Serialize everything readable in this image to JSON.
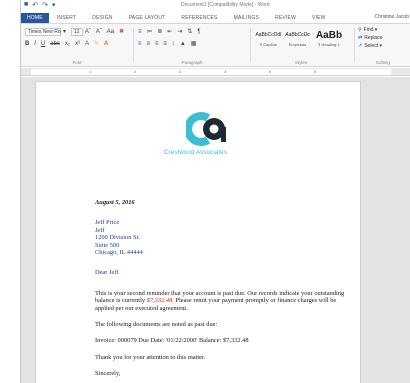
{
  "window": {
    "title": "Document1 [Compatibility Mode] - Word",
    "user": "Christine Jacob"
  },
  "tabs": [
    "HOME",
    "INSERT",
    "DESIGN",
    "PAGE LAYOUT",
    "REFERENCES",
    "MAILINGS",
    "REVIEW",
    "VIEW"
  ],
  "ribbon": {
    "font": {
      "name": "Times New Ro",
      "size": "12",
      "label": "Font"
    },
    "paragraph": {
      "label": "Paragraph"
    },
    "styles": {
      "label": "Styles",
      "items": [
        {
          "sample": "AaBbCcDdI",
          "name": "¶ Caption"
        },
        {
          "sample": "AaBbCcDc",
          "name": "Emphasis"
        },
        {
          "sample": "AaBb",
          "name": "¶ Heading 1"
        }
      ]
    },
    "editing": {
      "label": "Editing",
      "find": "Find",
      "replace": "Replace",
      "select": "Select"
    }
  },
  "ruler": [
    "1",
    "2",
    "3",
    "4",
    "5",
    "6"
  ],
  "document": {
    "logo_text": "Crestwood Associates",
    "date": "August 5, 2016",
    "address": [
      "Jeff Price",
      "Jeff",
      "1200 Division St.",
      "Suite 500",
      "Chicago, IL 44444"
    ],
    "greeting": "Dear Jeff",
    "para1_a": "This is your second reminder that your account is past due. Our records indicate your outstanding balance is currently ",
    "para1_amount": "$7,332.48.",
    "para1_b": " Please remit your payment promptly or finance charges will be applied per our executed agreement.",
    "para2": "The following documents are noted as past due:",
    "invoice_line": "Invoice: 000079  Due Date: '01/22/2000'  Balance: $7,332.48",
    "para3": "Thank you for your attention to this matter.",
    "closing": "Sincerely,"
  },
  "colors": {
    "accent": "#2b579a",
    "logo_dark": "#1f2a33",
    "logo_teal": "#3bbfd0",
    "address_blue": "#1f3a93",
    "amount_red": "#d01c1c"
  }
}
